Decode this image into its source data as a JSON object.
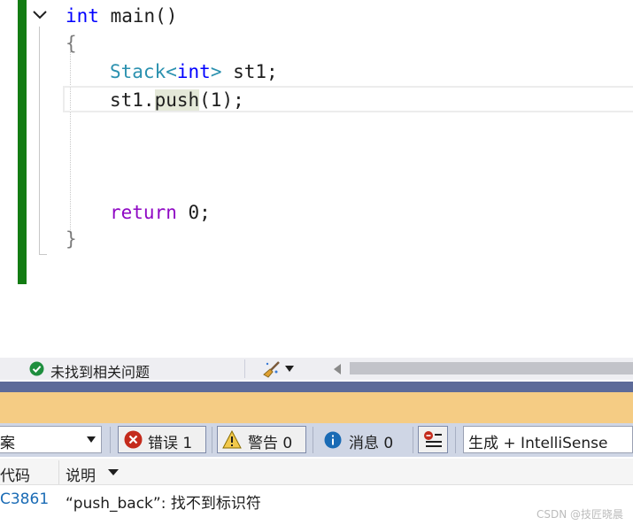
{
  "editor": {
    "lines": {
      "l1": {
        "kw": "int",
        "rest": " main()"
      },
      "l2": {
        "brace": "{"
      },
      "l3": {
        "type": "Stack",
        "lt": "<",
        "kw": "int",
        "gt": ">",
        "rest": " st1;"
      },
      "l4": {
        "obj": "st1.",
        "fn": "push",
        "rest": "(1);"
      },
      "l5": {
        "kw": "return",
        "rest": " 0;"
      },
      "l6": {
        "brace": "}"
      }
    }
  },
  "status": {
    "text": "未找到相关问题",
    "icons": {
      "ok": "check-circle-icon",
      "cleanup": "brush-icon"
    }
  },
  "toolbar": {
    "scope": "案",
    "errors_label": "错误 1",
    "warnings_label": "警告 0",
    "messages_label": "消息 0",
    "build_filter": "生成 + IntelliSense"
  },
  "error_list": {
    "columns": {
      "code": "代码",
      "description": "说明"
    },
    "rows": [
      {
        "code": "C3861",
        "description": "“push_back”: 找不到标识符"
      }
    ]
  },
  "watermark": "CSDN @技匠晓晨",
  "colors": {
    "change_bar": "#137c13",
    "keyword": "#0000ff",
    "return_keyword": "#8f08c4",
    "type": "#2b91af",
    "error_red": "#c42b1c",
    "warning_yellow": "#f2c94c",
    "info_blue": "#1a6bb5"
  }
}
